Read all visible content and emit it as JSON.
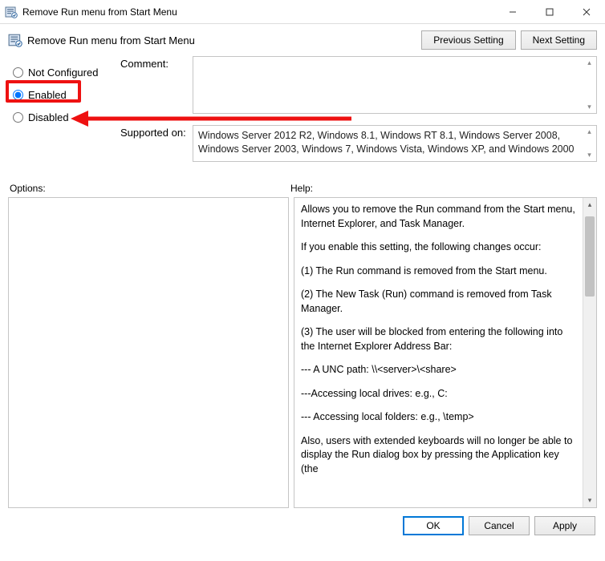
{
  "window": {
    "title": "Remove Run menu from Start Menu",
    "minimize_tip": "Minimize",
    "maximize_tip": "Maximize",
    "close_tip": "Close"
  },
  "header": {
    "policy_title": "Remove Run menu from Start Menu",
    "previous_btn": "Previous Setting",
    "next_btn": "Next Setting"
  },
  "radios": {
    "not_configured": "Not Configured",
    "enabled": "Enabled",
    "disabled": "Disabled",
    "selected": "enabled"
  },
  "fields": {
    "comment_label": "Comment:",
    "comment_value": "",
    "supported_label": "Supported on:",
    "supported_text": "Windows Server 2012 R2, Windows 8.1, Windows RT 8.1, Windows Server 2008, Windows Server 2003, Windows 7, Windows Vista, Windows XP, and Windows 2000"
  },
  "panels": {
    "options_label": "Options:",
    "help_label": "Help:"
  },
  "help_paragraphs": [
    "Allows you to remove the Run command from the Start menu, Internet Explorer, and Task Manager.",
    "If you enable this setting, the following changes occur:",
    "(1) The Run command is removed from the Start menu.",
    "(2) The New Task (Run) command is removed from Task Manager.",
    "(3) The user will be blocked from entering the following into the Internet Explorer Address Bar:",
    "--- A UNC path: \\\\<server>\\<share>",
    "---Accessing local drives:  e.g., C:",
    "--- Accessing local folders: e.g., \\temp>",
    "Also, users with extended keyboards will no longer be able to display the Run dialog box by pressing the Application key (the"
  ],
  "footer": {
    "ok": "OK",
    "cancel": "Cancel",
    "apply": "Apply"
  }
}
